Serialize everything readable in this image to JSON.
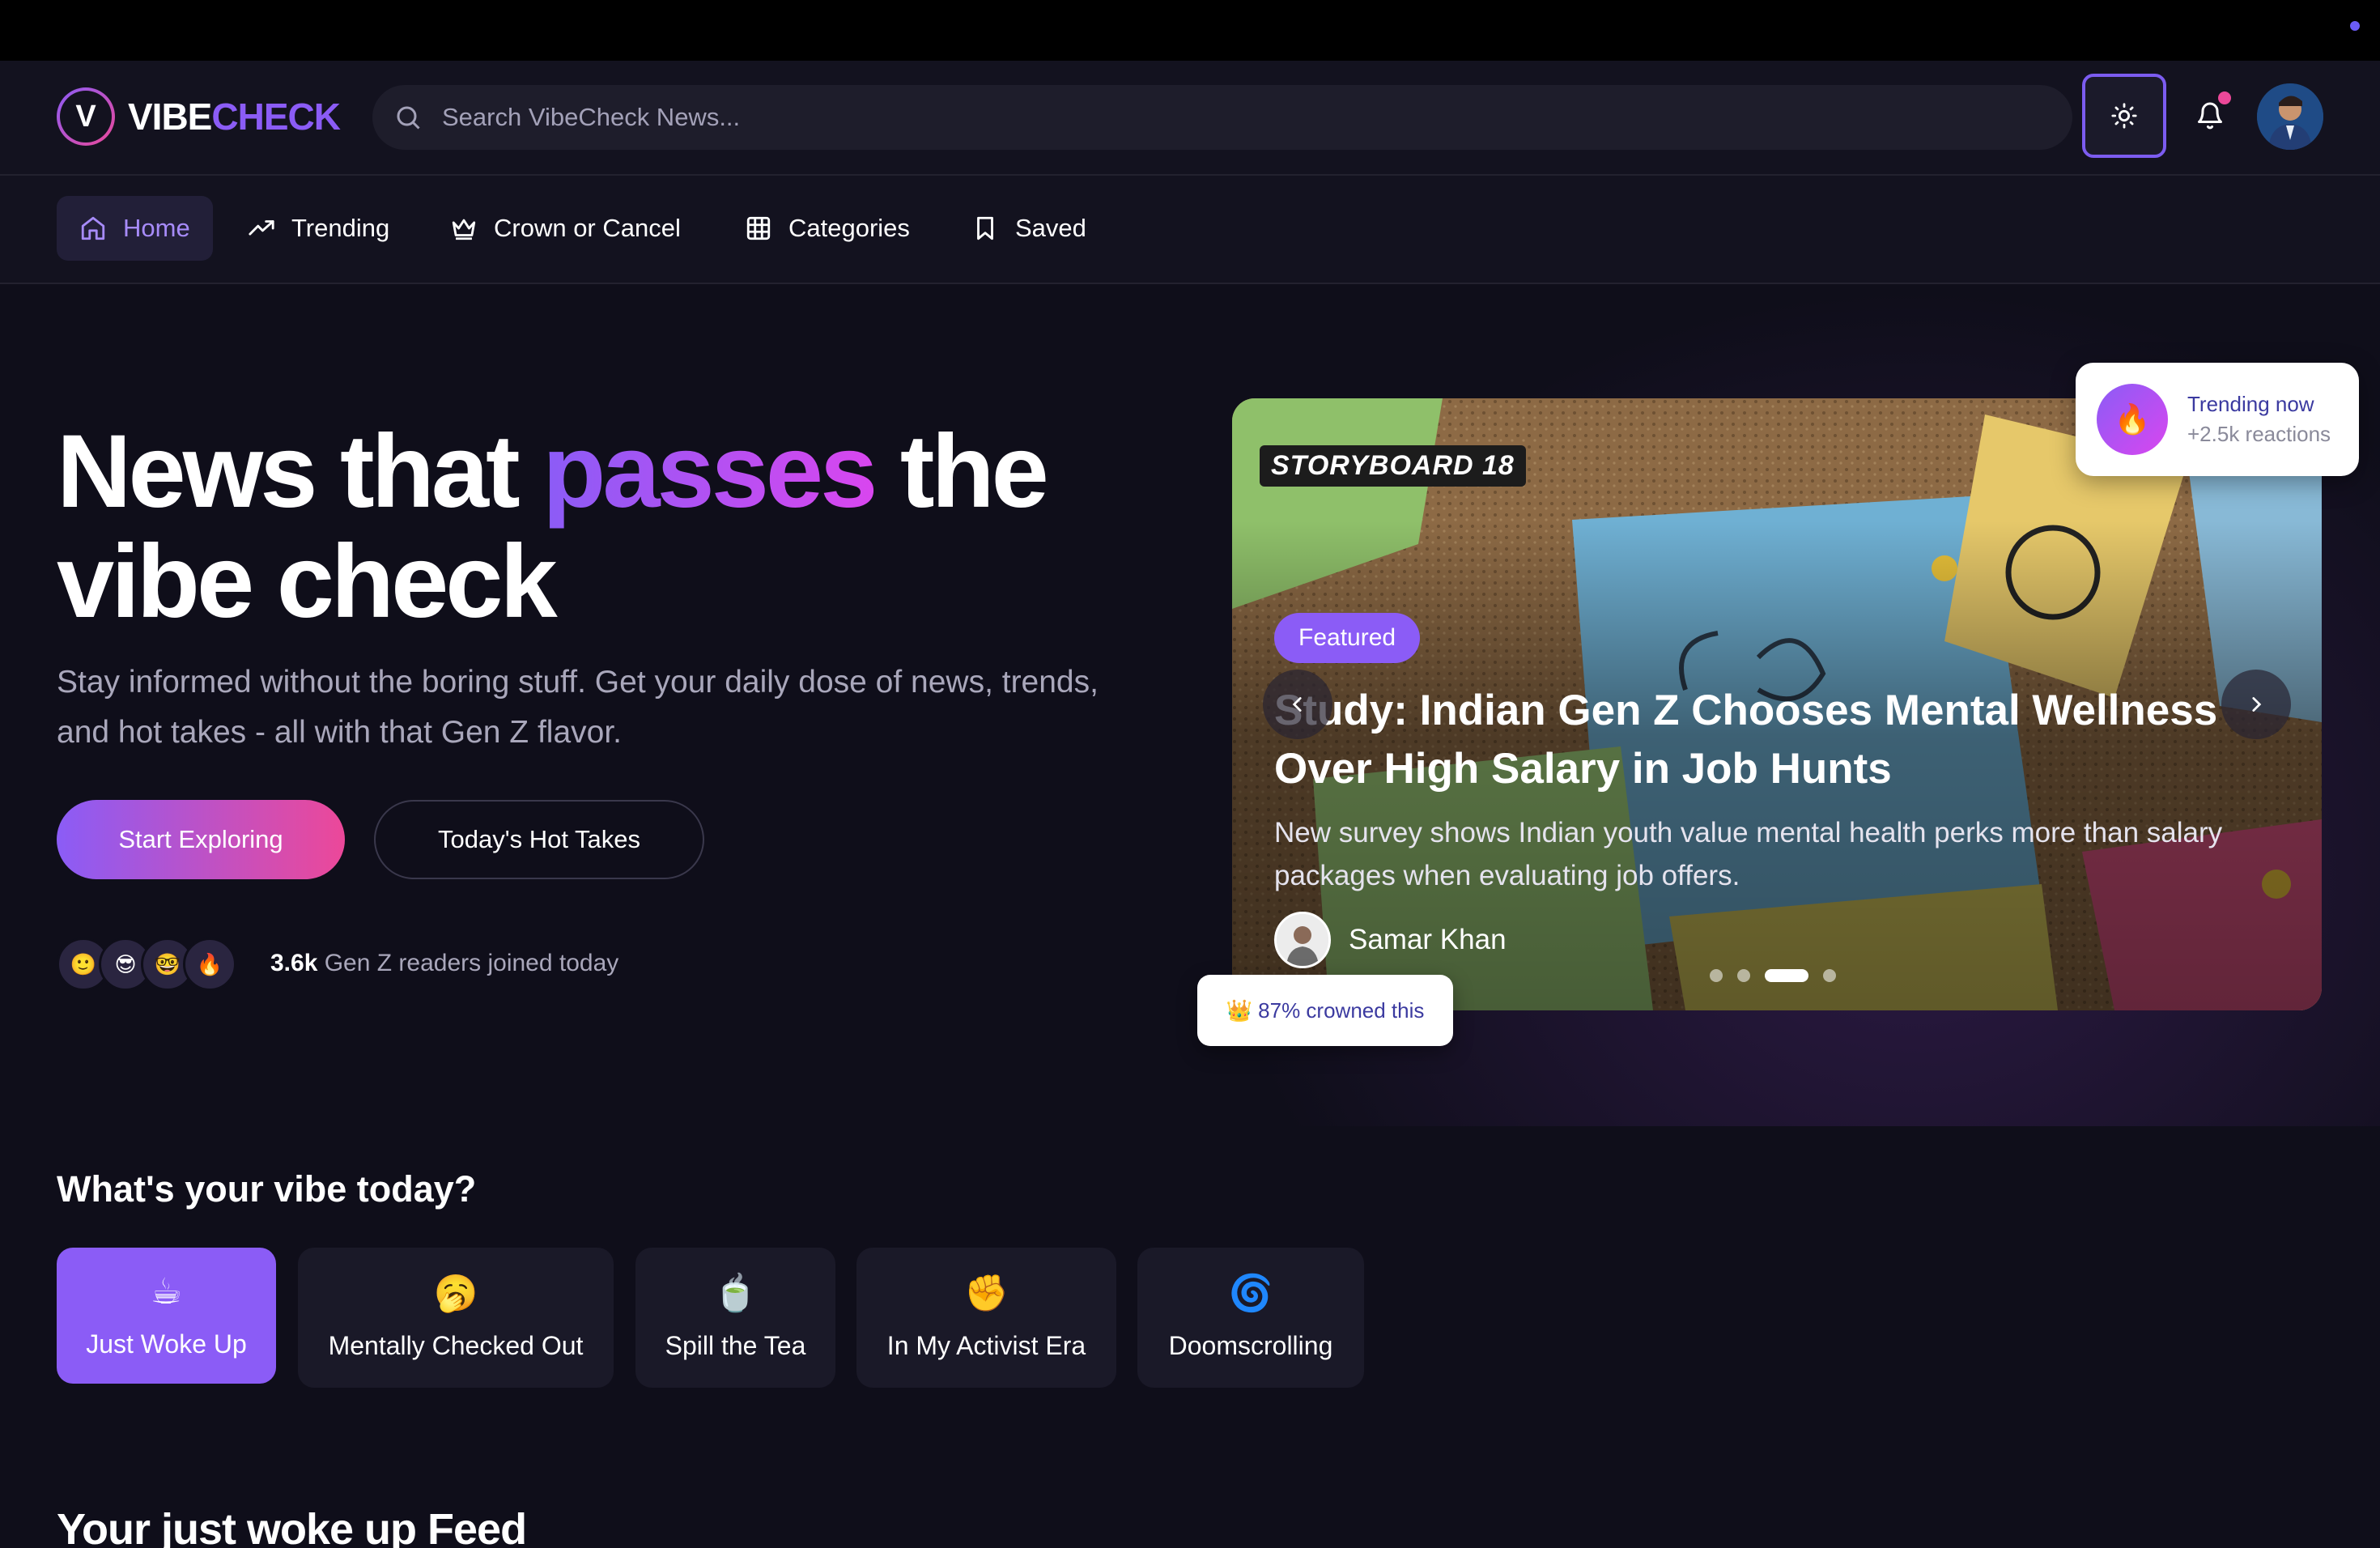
{
  "brand": {
    "name_part1": "VIBE",
    "name_part2": "CHECK",
    "badge_letter": "V"
  },
  "search": {
    "placeholder": "Search VibeCheck News..."
  },
  "nav": {
    "items": [
      {
        "label": "Home",
        "icon": "home-icon",
        "active": true
      },
      {
        "label": "Trending",
        "icon": "trending-icon"
      },
      {
        "label": "Crown or Cancel",
        "icon": "crown-icon"
      },
      {
        "label": "Categories",
        "icon": "grid-icon"
      },
      {
        "label": "Saved",
        "icon": "bookmark-icon"
      }
    ]
  },
  "hero": {
    "title_part1": "News that ",
    "title_highlight": "passes",
    "title_part2": " the vibe check",
    "subtitle": "Stay informed without the boring stuff. Get your daily dose of news, trends, and hot takes - all with that Gen Z flavor.",
    "primary_button": "Start Exploring",
    "secondary_button": "Today's Hot Takes",
    "reader_emojis": [
      "🙂",
      "😎",
      "🤓",
      "🔥"
    ],
    "readers_count": "3.6k",
    "readers_text": " Gen Z readers joined today"
  },
  "carousel": {
    "source_logo": "STORYBOARD 18",
    "badge": "Featured",
    "title": "Study: Indian Gen Z Chooses Mental Wellness Over High Salary in Job Hunts",
    "description": "New survey shows Indian youth value mental health perks more than salary packages when evaluating job offers.",
    "author": "Samar Khan",
    "slide_count": 4,
    "active_slide": 3
  },
  "trending_card": {
    "title": "Trending now",
    "subtitle": "+2.5k reactions",
    "icon": "🔥"
  },
  "crown_card": {
    "text": "👑 87% crowned this"
  },
  "vibe": {
    "heading": "What's your vibe today?",
    "options": [
      {
        "emoji": "☕",
        "label": "Just Woke Up",
        "active": true
      },
      {
        "emoji": "🥱",
        "label": "Mentally Checked Out"
      },
      {
        "emoji": "🍵",
        "label": "Spill the Tea"
      },
      {
        "emoji": "✊",
        "label": "In My Activist Era"
      },
      {
        "emoji": "🌀",
        "label": "Doomscrolling"
      }
    ]
  },
  "feed": {
    "heading": "Your just woke up Feed"
  },
  "colors": {
    "accent": "#8b5cf6",
    "accent_pink": "#ec4899",
    "background": "#0f0e1a"
  }
}
